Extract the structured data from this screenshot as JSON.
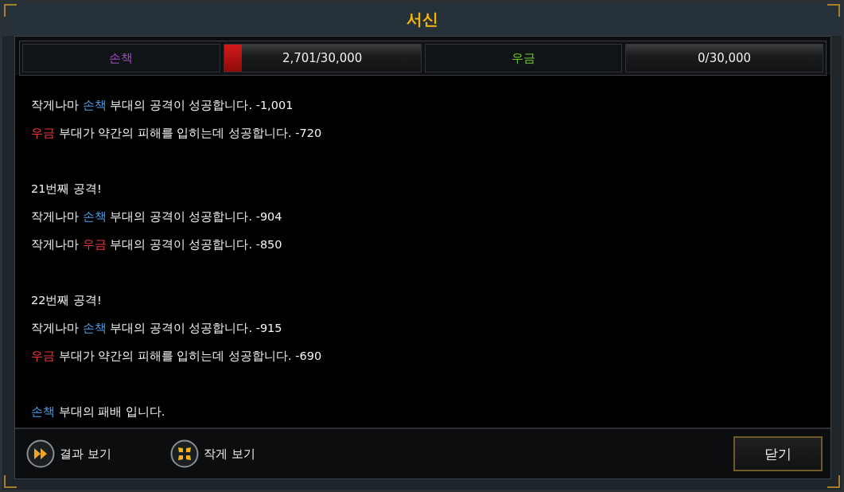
{
  "window": {
    "title": "서신"
  },
  "score_bar": [
    {
      "kind": "label",
      "text": "손책",
      "color": "#9b4fc4"
    },
    {
      "kind": "meter",
      "reading": "2,701/30,000",
      "level": 0.09
    },
    {
      "kind": "label",
      "text": "우금",
      "color": "#6cc62a"
    },
    {
      "kind": "meter",
      "reading": "0/30,000"
    }
  ],
  "log": [
    {
      "lines": [
        [
          {
            "text": "작게나마 "
          },
          {
            "text": "손책",
            "color": "#4d9ee8"
          },
          {
            "text": " 부대의 공격이 성공합니다. -1,001"
          }
        ],
        [
          {
            "text": "우금",
            "color": "#e8383a"
          },
          {
            "text": " 부대가 약간의 피해를 입히는데 성공합니다. -720"
          }
        ]
      ]
    },
    {
      "lines": [
        [
          {
            "text": "21번째 공격!"
          }
        ],
        [
          {
            "text": "작게나마 "
          },
          {
            "text": "손책",
            "color": "#4d9ee8"
          },
          {
            "text": " 부대의 공격이 성공합니다. -904"
          }
        ],
        [
          {
            "text": "작게나마 "
          },
          {
            "text": "우금",
            "color": "#e8383a"
          },
          {
            "text": " 부대의 공격이 성공합니다. -850"
          }
        ]
      ]
    },
    {
      "lines": [
        [
          {
            "text": "22번째 공격!"
          }
        ],
        [
          {
            "text": "작게나마 "
          },
          {
            "text": "손책",
            "color": "#4d9ee8"
          },
          {
            "text": " 부대의 공격이 성공합니다. -915"
          }
        ],
        [
          {
            "text": "우금",
            "color": "#e8383a"
          },
          {
            "text": " 부대가 약간의 피해를 입히는데 성공합니다. -690"
          }
        ]
      ]
    },
    {
      "lines": [
        [
          {
            "text": "손책",
            "color": "#4d9ee8"
          },
          {
            "text": " 부대의 패배 입니다."
          }
        ]
      ]
    }
  ],
  "footer": {
    "actions": [
      {
        "kind": "skip",
        "label": "결과 보기"
      },
      {
        "kind": "shrink",
        "label": "작게 보기"
      }
    ],
    "close": "닫기"
  }
}
